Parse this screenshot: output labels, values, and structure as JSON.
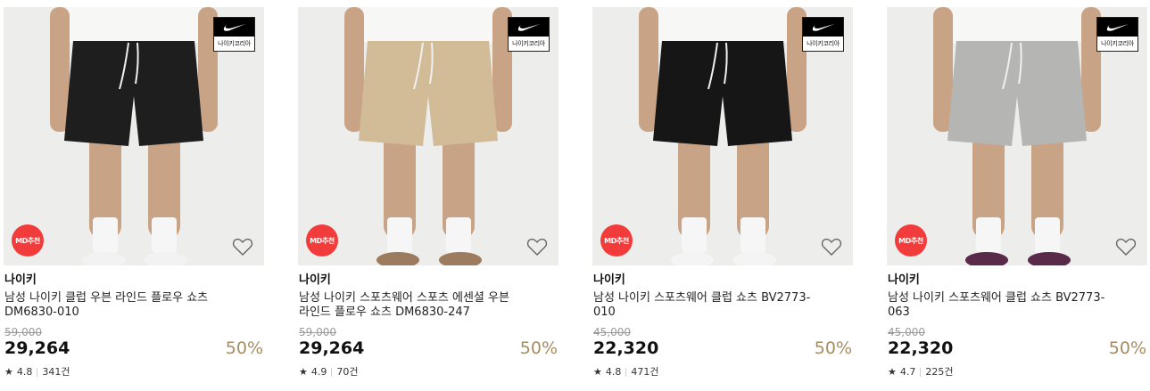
{
  "products": [
    {
      "brand": "나이키",
      "title": "남성 나이키 클럽 우븐 라인드 플로우 쇼츠 DM6830-010",
      "original_price": "59,000",
      "price": "29,264",
      "discount": "50%",
      "rating": "4.8",
      "reviews": "341건",
      "md_badge": "MD추천",
      "brand_badge": "나이키코리아",
      "shorts_color": "#1e1e1e",
      "shoe_color": "#f2f2f2"
    },
    {
      "brand": "나이키",
      "title": "남성 나이키 스포츠웨어 스포츠 에센셜 우븐 라인드 플로우 쇼츠 DM6830-247",
      "original_price": "59,000",
      "price": "29,264",
      "discount": "50%",
      "rating": "4.9",
      "reviews": "70건",
      "md_badge": "MD추천",
      "brand_badge": "나이키코리아",
      "shorts_color": "#d2bc97",
      "shoe_color": "#9c7b5e"
    },
    {
      "brand": "나이키",
      "title": "남성 나이키 스포츠웨어 클럽 쇼츠 BV2773-010",
      "original_price": "45,000",
      "price": "22,320",
      "discount": "50%",
      "rating": "4.8",
      "reviews": "471건",
      "md_badge": "MD추천",
      "brand_badge": "나이키코리아",
      "shorts_color": "#161616",
      "shoe_color": "#f4f4f4"
    },
    {
      "brand": "나이키",
      "title": "남성 나이키 스포츠웨어 클럽 쇼츠 BV2773-063",
      "original_price": "45,000",
      "price": "22,320",
      "discount": "50%",
      "rating": "4.7",
      "reviews": "225건",
      "md_badge": "MD추천",
      "brand_badge": "나이키코리아",
      "shorts_color": "#b5b5b3",
      "shoe_color": "#5a2a4a"
    }
  ]
}
